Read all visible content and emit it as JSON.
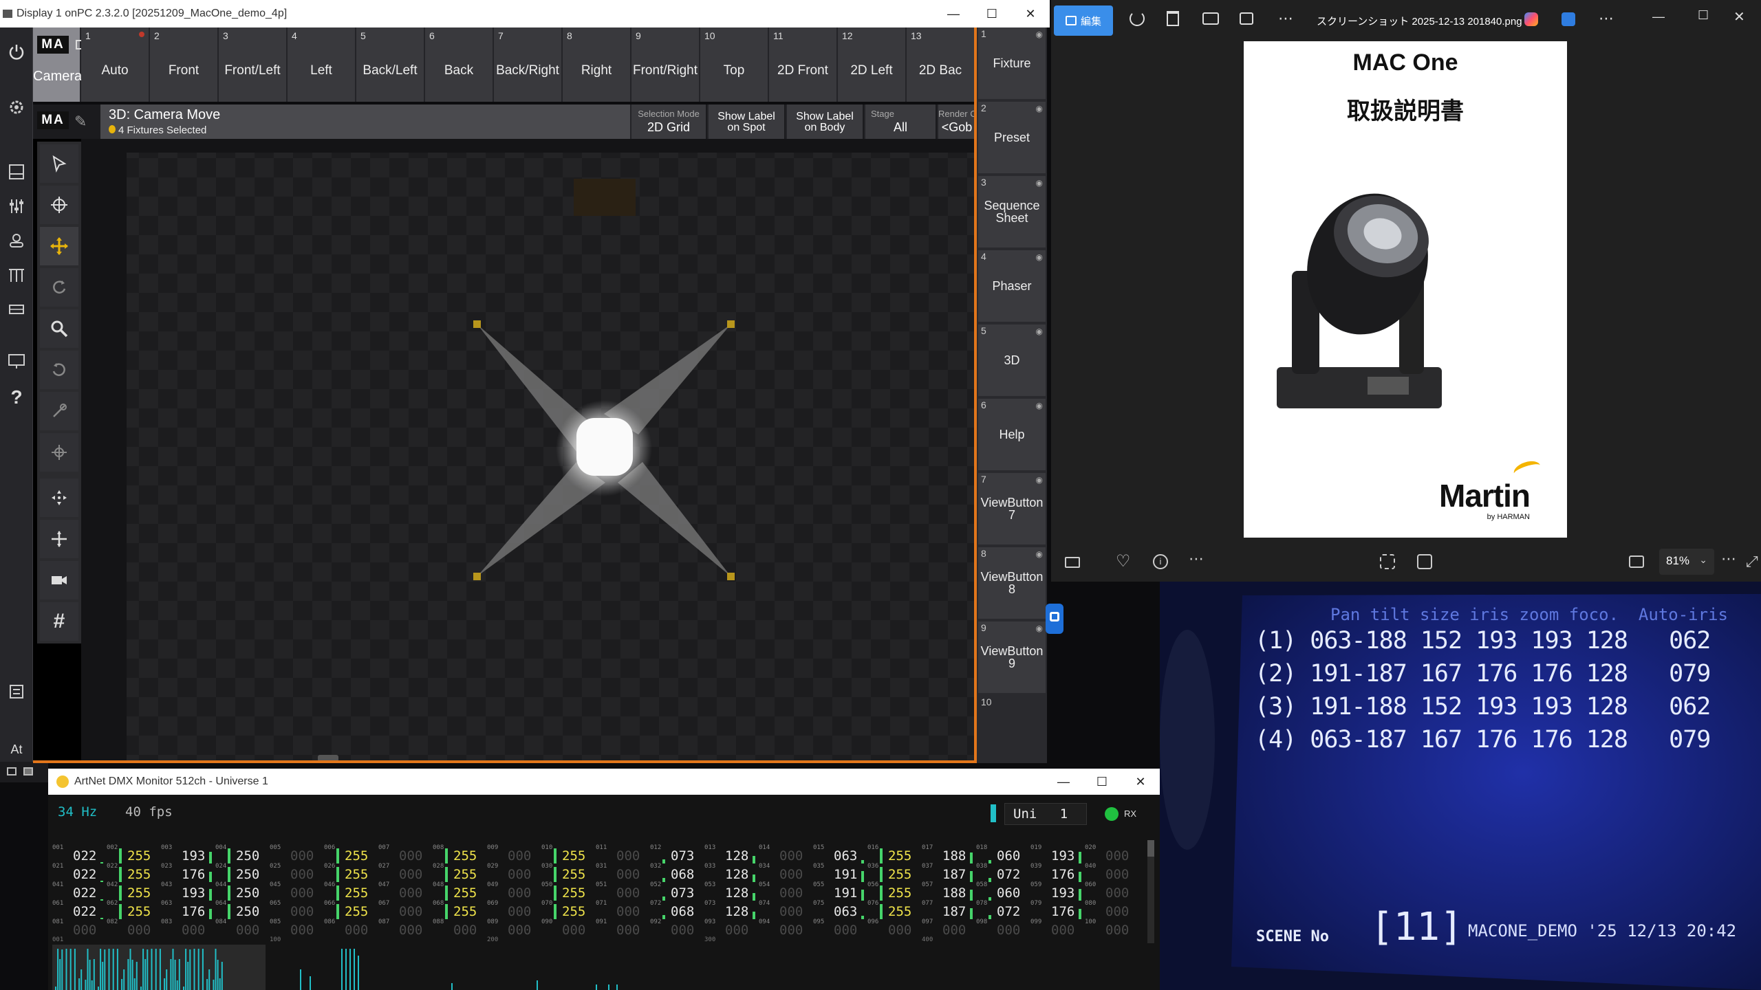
{
  "ma_window": {
    "title": "Display 1 onPC 2.3.2.0 [20251209_MacOne_demo_4p]",
    "logo": "MA",
    "cameras_label": "Cameras",
    "camera_buttons": [
      {
        "num": "1",
        "label": "Auto"
      },
      {
        "num": "2",
        "label": "Front"
      },
      {
        "num": "3",
        "label": "Front/Left"
      },
      {
        "num": "4",
        "label": "Left"
      },
      {
        "num": "5",
        "label": "Back/Left"
      },
      {
        "num": "6",
        "label": "Back"
      },
      {
        "num": "7",
        "label": "Back/Right"
      },
      {
        "num": "8",
        "label": "Right"
      },
      {
        "num": "9",
        "label": "Front/Right"
      },
      {
        "num": "10",
        "label": "Top"
      },
      {
        "num": "11",
        "label": "2D Front"
      },
      {
        "num": "12",
        "label": "2D Left"
      },
      {
        "num": "13",
        "label": "2D Bac"
      }
    ],
    "view_title": "3D: Camera Move",
    "fixtures_selected": "4 Fixtures Selected",
    "header_buttons": [
      {
        "label": "Selection Mode",
        "value": "2D Grid"
      },
      {
        "label": "",
        "value": "Show Label on Spot"
      },
      {
        "label": "",
        "value": "Show Label on Body"
      },
      {
        "label": "Stage",
        "value": "All"
      },
      {
        "label": "Render C",
        "value": "<Gob"
      }
    ],
    "left_bottom_text": "At",
    "view_buttons": [
      {
        "num": "1",
        "label": "Fixture"
      },
      {
        "num": "2",
        "label": "Preset"
      },
      {
        "num": "3",
        "label": "Sequence Sheet"
      },
      {
        "num": "4",
        "label": "Phaser"
      },
      {
        "num": "5",
        "label": "3D"
      },
      {
        "num": "6",
        "label": "Help"
      },
      {
        "num": "7",
        "label": "ViewButton 7"
      },
      {
        "num": "8",
        "label": "ViewButton 8"
      },
      {
        "num": "9",
        "label": "ViewButton 9"
      },
      {
        "num": "10",
        "label": ""
      }
    ]
  },
  "artnet": {
    "title": "ArtNet DMX Monitor 512ch - Universe 1",
    "hz": "34 Hz",
    "fps": "40 fps",
    "universe_label": "Uni",
    "universe": "1",
    "rx": "RX",
    "rows": [
      [
        "001",
        "022",
        "002",
        "255",
        "003",
        "193",
        "004",
        "250",
        "005",
        "000",
        "006",
        "255",
        "007",
        "000",
        "008",
        "255",
        "009",
        "000",
        "010",
        "255",
        "011",
        "000",
        "012",
        "073",
        "013",
        "128",
        "014",
        "000",
        "015",
        "063",
        "016",
        "255",
        "017",
        "188",
        "018",
        "060",
        "019",
        "193",
        "020",
        "000"
      ],
      [
        "021",
        "022",
        "022",
        "255",
        "023",
        "176",
        "024",
        "250",
        "025",
        "000",
        "026",
        "255",
        "027",
        "000",
        "028",
        "255",
        "029",
        "000",
        "030",
        "255",
        "031",
        "000",
        "032",
        "068",
        "033",
        "128",
        "034",
        "000",
        "035",
        "191",
        "036",
        "255",
        "037",
        "187",
        "038",
        "072",
        "039",
        "176",
        "040",
        "000"
      ],
      [
        "041",
        "022",
        "042",
        "255",
        "043",
        "193",
        "044",
        "250",
        "045",
        "000",
        "046",
        "255",
        "047",
        "000",
        "048",
        "255",
        "049",
        "000",
        "050",
        "255",
        "051",
        "000",
        "052",
        "073",
        "053",
        "128",
        "054",
        "000",
        "055",
        "191",
        "056",
        "255",
        "057",
        "188",
        "058",
        "060",
        "059",
        "193",
        "060",
        "000"
      ],
      [
        "061",
        "022",
        "062",
        "255",
        "063",
        "176",
        "064",
        "250",
        "065",
        "000",
        "066",
        "255",
        "067",
        "000",
        "068",
        "255",
        "069",
        "000",
        "070",
        "255",
        "071",
        "000",
        "072",
        "068",
        "073",
        "128",
        "074",
        "000",
        "075",
        "063",
        "076",
        "255",
        "077",
        "187",
        "078",
        "072",
        "079",
        "176",
        "080",
        "000"
      ],
      [
        "081",
        "000",
        "082",
        "000",
        "083",
        "000",
        "084",
        "000",
        "085",
        "000",
        "086",
        "000",
        "087",
        "000",
        "088",
        "000",
        "089",
        "000",
        "090",
        "000",
        "091",
        "000",
        "092",
        "000",
        "093",
        "000",
        "094",
        "000",
        "095",
        "000",
        "096",
        "000",
        "097",
        "000",
        "098",
        "000",
        "099",
        "000",
        "100",
        "000"
      ]
    ],
    "bargraph_ticks": [
      "001",
      "100",
      "200",
      "300",
      "400"
    ]
  },
  "photos": {
    "edit_label": "編集",
    "filename": "スクリーンショット 2025-12-13 201840.png",
    "zoom": "81%",
    "doc_title": "MAC One",
    "doc_subtitle": "取扱説明書",
    "brand": "Martin",
    "brand_sub": "by HARMAN"
  },
  "lcd": {
    "header": "Pan tilt size iris zoom foco.  Auto-iris",
    "rows": [
      "(1) 063-188 152 193 193 128   062",
      "(2) 191-187 167 176 176 128   079",
      "(3) 191-188 152 193 193 128   062",
      "(4) 063-187 167 176 176 128   079"
    ],
    "scene_label": "SCENE No",
    "scene_value": "[11]",
    "footer": "MACONE_DEMO '25 12/13 20:42"
  },
  "colors": {
    "accent_orange": "#e2761b",
    "accent_yellow": "#e8b40c",
    "dmx_yellow": "#f0e44a",
    "dmx_green": "#46d46a",
    "artnet_teal": "#21bfc7",
    "lcd_blue": "#18247a"
  }
}
